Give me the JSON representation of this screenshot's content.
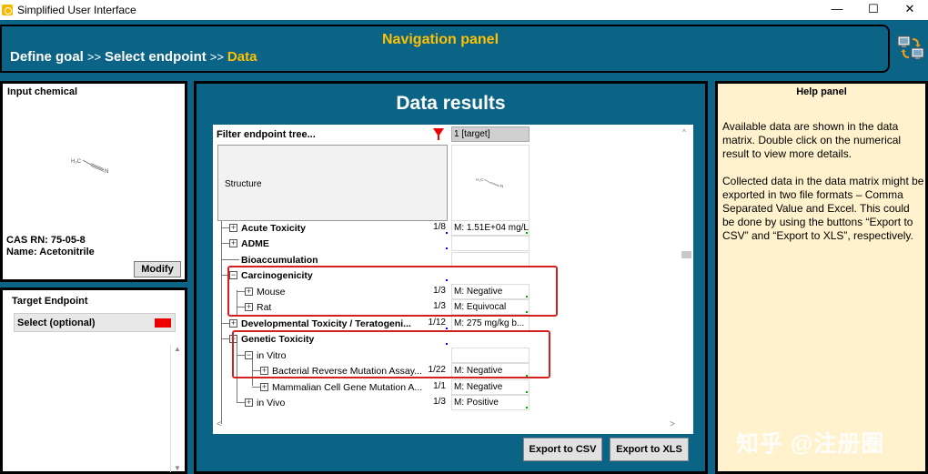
{
  "window": {
    "title": "Simplified User Interface",
    "min": "—",
    "max": "☐",
    "close": "✕"
  },
  "nav": {
    "title": "Navigation panel",
    "steps": [
      "Define goal",
      "Select endpoint"
    ],
    "separator": ">>",
    "current": "Data"
  },
  "input_chemical": {
    "label": "Input chemical",
    "cas": "CAS RN: 75-05-8",
    "name": "Name: Acetonitrile",
    "modify": "Modify"
  },
  "target_endpoint": {
    "label": "Target Endpoint",
    "item": "Select (optional)",
    "item_color": "#e00000"
  },
  "data_results": {
    "title": "Data results",
    "filter": "Filter endpoint tree...",
    "column": "1 [target]",
    "structure_label": "Structure",
    "rows": [
      {
        "label": "Acute Toxicity",
        "count": "1/8",
        "value": "M: 1.51E+04 mg/L"
      },
      {
        "label": "ADME",
        "count": "",
        "value": ""
      },
      {
        "label": "Bioaccumulation",
        "count": "",
        "value": ""
      },
      {
        "label": "Carcinogenicity",
        "count": "",
        "value": ""
      },
      {
        "label": "Mouse",
        "count": "1/3",
        "value": "M: Negative"
      },
      {
        "label": "Rat",
        "count": "1/3",
        "value": "M: Equivocal"
      },
      {
        "label": "Developmental Toxicity / Teratogeni...",
        "count": "1/12",
        "value": "M: 275 mg/kg b..."
      },
      {
        "label": "Genetic Toxicity",
        "count": "",
        "value": ""
      },
      {
        "label": "in Vitro",
        "count": "",
        "value": ""
      },
      {
        "label": "Bacterial Reverse Mutation Assay...",
        "count": "1/22",
        "value": "M: Negative"
      },
      {
        "label": "Mammalian Cell Gene Mutation A...",
        "count": "1/1",
        "value": "M: Negative"
      },
      {
        "label": "in Vivo",
        "count": "1/3",
        "value": "M: Positive"
      }
    ],
    "export_csv": "Export to CSV",
    "export_xls": "Export to XLS"
  },
  "help": {
    "title": "Help panel",
    "p1": "Available data are shown in the data matrix. Double click on the numerical result to view more details.",
    "p2": "Collected data in the data matrix might be exported in two file formats – Comma Separated Value and Excel. This could be done by using the buttons “Export to CSV” and “Export to XLS”, respectively.",
    "watermark": "知乎 @注册圈"
  },
  "colors": {
    "panel_blue": "#0b6486",
    "accent_yellow": "#ffc000",
    "help_bg": "#fff2cc",
    "highlight_red": "#d32020"
  }
}
